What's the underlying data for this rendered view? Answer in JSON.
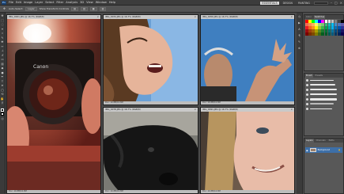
{
  "app": {
    "logo": "Ps",
    "menu": [
      "File",
      "Edit",
      "Image",
      "Layer",
      "Select",
      "Filter",
      "Analysis",
      "3D",
      "View",
      "Window",
      "Help"
    ],
    "workspaces": [
      "ESSENTIALS",
      "DESIGN",
      "PAINTING"
    ],
    "active_workspace": "ESSENTIALS"
  },
  "options": {
    "items": [
      "Auto-Select:",
      "Layer",
      "Show Transform Controls"
    ]
  },
  "docs": [
    {
      "tab": "IMG_0001.JPG @ 16.7% (RGB/8)",
      "status": "Doc: 10.8M/10.8M"
    },
    {
      "tab": "IMG_0034.JPG @ 16.7% (RGB/8)",
      "status": "Doc: 10.8M/10.8M"
    },
    {
      "tab": "IMG_0056.JPG @ 16.7% (RGB/8)",
      "status": "Doc: 10.8M/10.8M"
    },
    {
      "tab": "IMG_0078.JPG @ 16.7% (RGB/8)",
      "status": "Doc: 10.8M/10.8M"
    },
    {
      "tab": "IMG_0091.JPG @ 16.7% (RGB/8)",
      "status": "Doc: 10.8M/10.8M"
    }
  ],
  "camera_brand": "Canon",
  "panels": {
    "color_tabs": [
      "Color",
      "Swatches"
    ],
    "brush_tabs": [
      "Brush",
      "Presets"
    ],
    "layer_tabs": [
      "Layers",
      "Channels",
      "Paths"
    ],
    "layer_name": "Background"
  },
  "swatch_colors": [
    "#ff0000",
    "#ffff00",
    "#00ff00",
    "#00ffff",
    "#0000ff",
    "#ff00ff",
    "#ffffff",
    "#e0e0e0",
    "#c0c0c0",
    "#808080",
    "#404040",
    "#000000",
    "#f26c4f",
    "#f68e55",
    "#fbaf5c",
    "#fff467",
    "#acd372",
    "#7cc576",
    "#3bb878",
    "#1abbb4",
    "#00bff3",
    "#438ccb",
    "#5574b9",
    "#605ca8",
    "#ed1c24",
    "#f26522",
    "#f7941d",
    "#fff200",
    "#8dc73f",
    "#39b54a",
    "#00a651",
    "#00a99d",
    "#00aeef",
    "#0072bc",
    "#0054a6",
    "#2e3192",
    "#9e0b0f",
    "#a0410d",
    "#a36209",
    "#aba000",
    "#598527",
    "#1a7b30",
    "#007236",
    "#00746b",
    "#0076a3",
    "#004b80",
    "#003471",
    "#1b1464",
    "#790000",
    "#7b2e00",
    "#7d4900",
    "#827b00",
    "#406618",
    "#005e20",
    "#005826",
    "#005952",
    "#005b7f",
    "#003663",
    "#002157",
    "#0d004c"
  ]
}
